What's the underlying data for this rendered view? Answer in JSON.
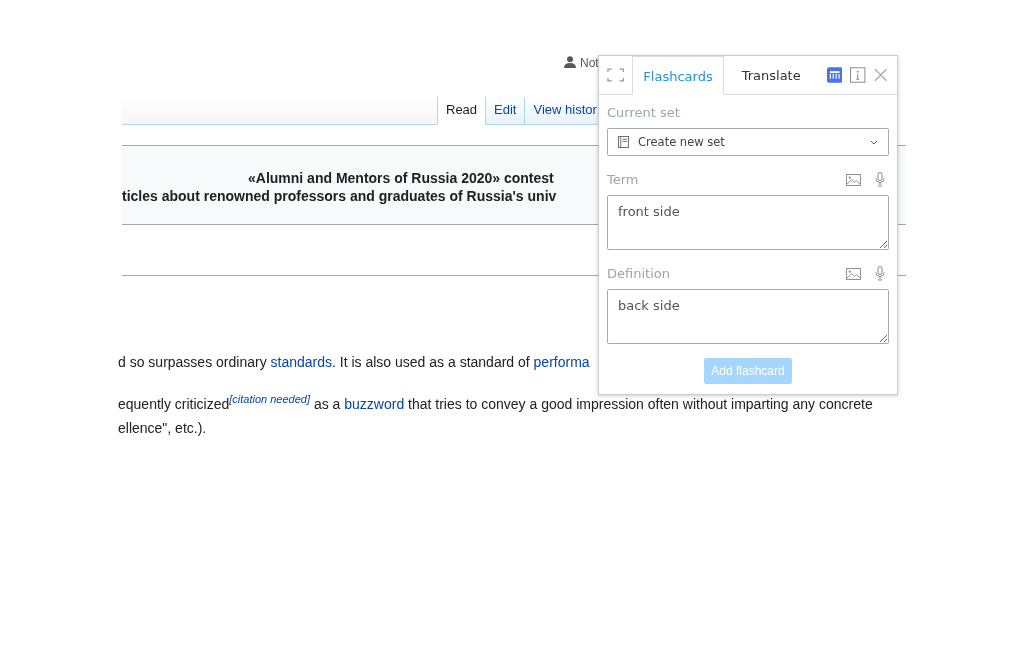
{
  "user_menu": {
    "label": "Not"
  },
  "page_tabs": [
    {
      "label": "Read",
      "selected": true
    },
    {
      "label": "Edit",
      "selected": false
    },
    {
      "label": "View histor",
      "selected": false
    }
  ],
  "banner": {
    "lines": [
      "«Alumni and Mentors of Russia 2020» contest",
      "ticles about renowned professors and graduates of Russia's univ"
    ]
  },
  "paragraphs": [
    {
      "lines": [
        [
          {
            "kind": "text",
            "text": "d so surpasses ordinary "
          },
          {
            "kind": "link",
            "text": "standards"
          },
          {
            "kind": "text",
            "text": ". It is also used as a standard of "
          },
          {
            "kind": "link",
            "text": "performa"
          }
        ]
      ]
    },
    {
      "lines": [
        [
          {
            "kind": "text",
            "text": "equently criticized"
          },
          {
            "kind": "citation",
            "text": "[citation needed]"
          },
          {
            "kind": "text",
            "text": " as a "
          },
          {
            "kind": "link",
            "text": "buzzword"
          },
          {
            "kind": "text",
            "text": " that tries to convey a good impression often without imparting any concrete"
          }
        ],
        [
          {
            "kind": "text",
            "text": "ellence\", etc.)."
          }
        ]
      ]
    }
  ],
  "popup": {
    "tabs": [
      {
        "label": "Flashcards",
        "selected": true
      },
      {
        "label": "Translate",
        "selected": false
      }
    ],
    "current_set": {
      "label": "Current set",
      "value": "Create new set"
    },
    "fields": [
      {
        "label": "Term",
        "value": "front side"
      },
      {
        "label": "Definition",
        "value": "back side"
      }
    ],
    "button": {
      "label": "Add flashcard",
      "disabled": true
    }
  }
}
